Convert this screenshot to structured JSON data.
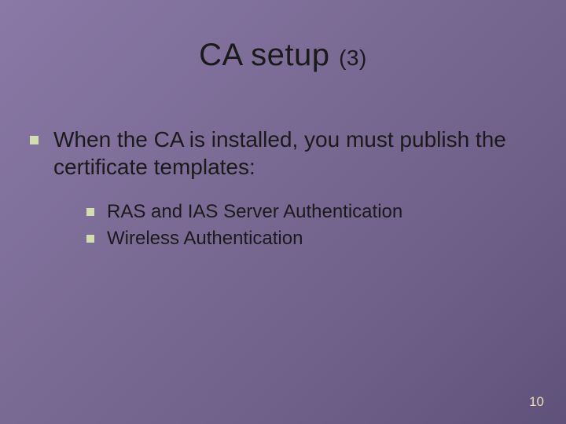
{
  "title": {
    "main": "CA setup ",
    "sub": "(3)"
  },
  "bullets": {
    "lvl1": "When the CA is installed, you must publish the certificate templates:",
    "lvl2": [
      "RAS and IAS Server Authentication",
      "Wireless Authentication"
    ]
  },
  "page_number": "10"
}
